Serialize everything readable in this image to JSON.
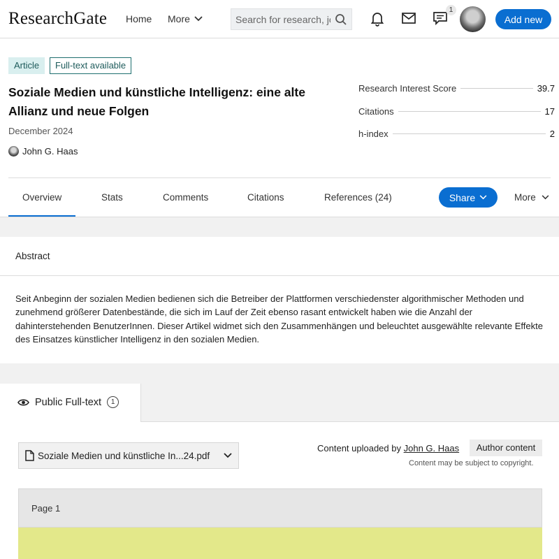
{
  "header": {
    "logo": "ResearchGate",
    "nav_home": "Home",
    "nav_more": "More",
    "search_placeholder": "Search for research, jou",
    "messages_badge": "1",
    "add_new": "Add new"
  },
  "article": {
    "type_tag": "Article",
    "fulltext_tag": "Full-text available",
    "title": "Soziale Medien und künstliche Intelligenz: eine alte Allianz und neue Folgen",
    "date": "December 2024",
    "author": "John G. Haas"
  },
  "metrics": [
    {
      "label": "Research Interest Score",
      "value": "39.7"
    },
    {
      "label": "Citations",
      "value": "17"
    },
    {
      "label": "h-index",
      "value": "2"
    }
  ],
  "tabs": {
    "overview": "Overview",
    "stats": "Stats",
    "comments": "Comments",
    "citations": "Citations",
    "references": "References (24)",
    "share": "Share",
    "more": "More"
  },
  "abstract": {
    "heading": "Abstract",
    "text": "Seit Anbeginn der sozialen Medien bedienen sich die Betreiber der Plattformen verschiedenster algorithmischer Methoden und zunehmend größerer Datenbestände, die sich im Lauf der Zeit ebenso rasant entwickelt haben wie die Anzahl der dahinterstehenden BenutzerInnen. Dieser Artikel widmet sich den Zusammenhängen und beleuchtet ausgewählte relevante Effekte des Einsatzes künstlicher Intelligenz in den sozialen Medien."
  },
  "fulltext": {
    "tab_label": "Public Full-text",
    "tab_count": "1",
    "file_name": "Soziale Medien und künstliche In...24.pdf",
    "uploaded_prefix": "Content uploaded by",
    "uploaded_by": "John G. Haas",
    "author_content": "Author content",
    "copyright": "Content may be subject to copyright.",
    "page_label": "Page 1"
  },
  "colors": {
    "accent": "#0a6ed1",
    "tag_bg": "#d9efef",
    "pdf_page": "#e3e88a"
  }
}
